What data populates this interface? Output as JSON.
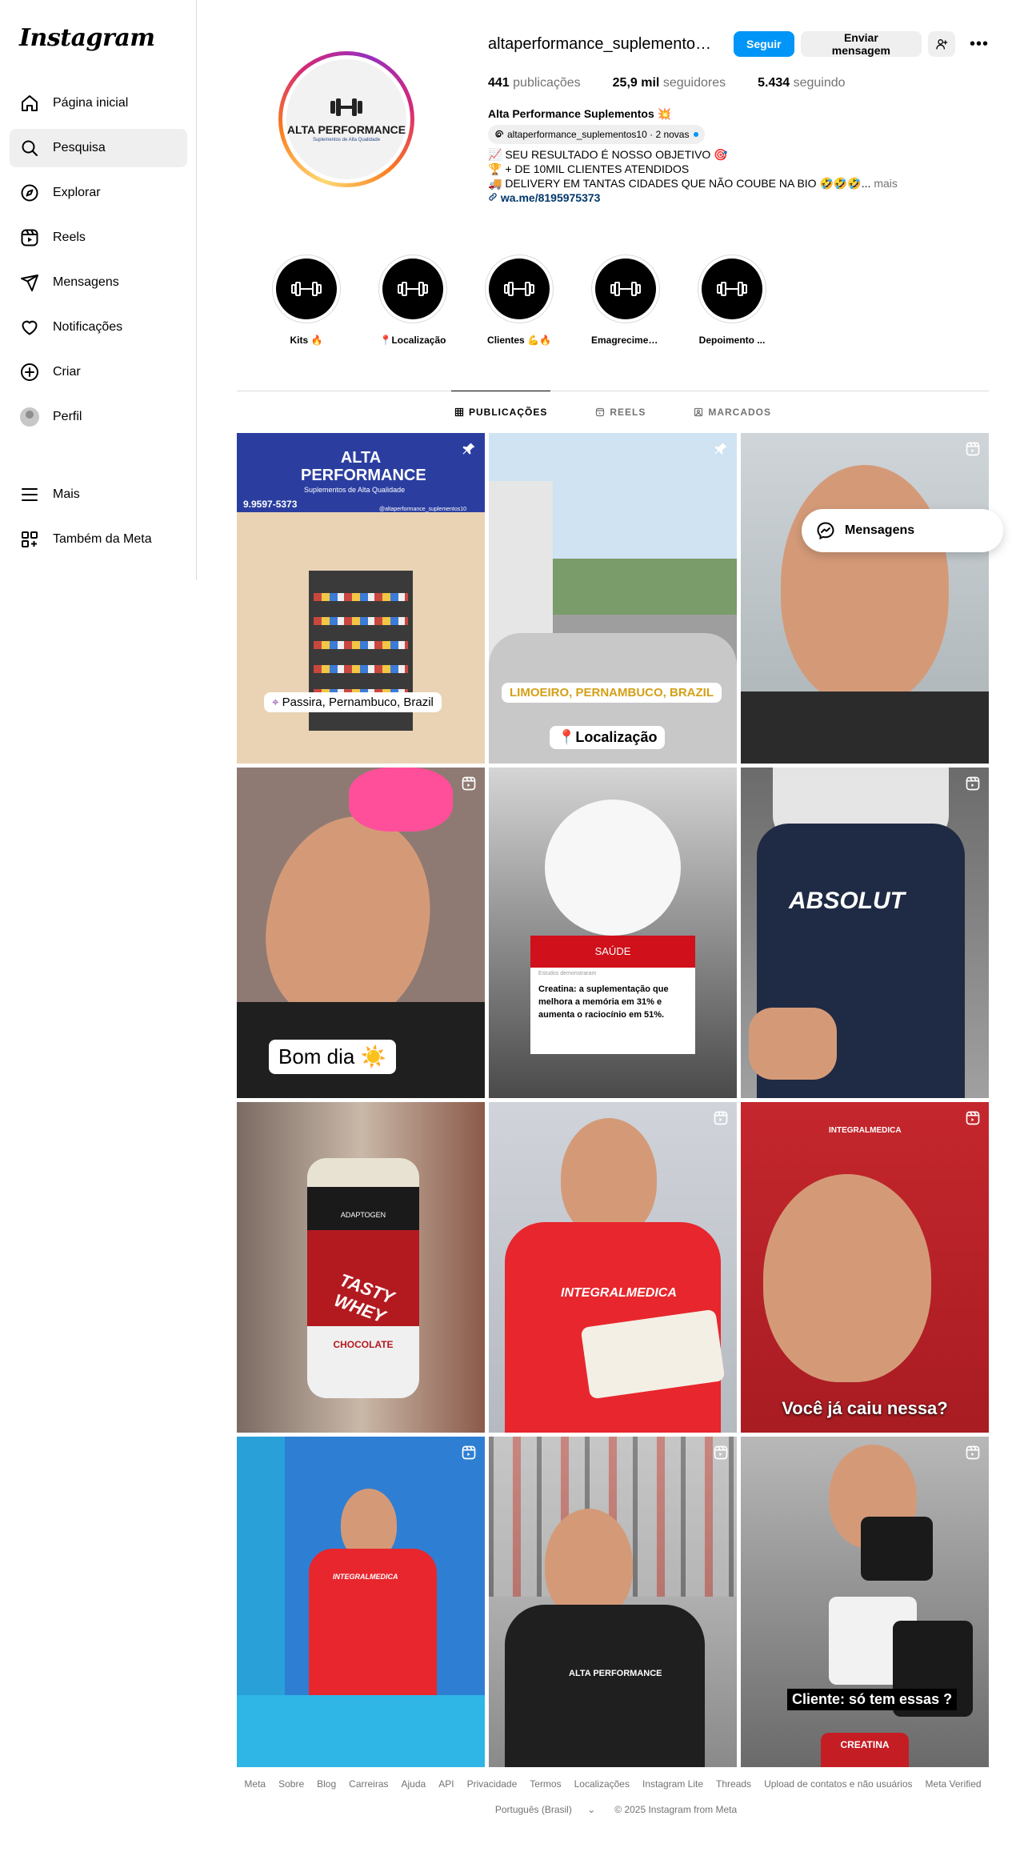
{
  "app": {
    "logo_text": "Instagram"
  },
  "sidebar": {
    "items": [
      {
        "label": "Página inicial",
        "icon": "home-icon"
      },
      {
        "label": "Pesquisa",
        "icon": "search-icon",
        "active": true
      },
      {
        "label": "Explorar",
        "icon": "compass-icon"
      },
      {
        "label": "Reels",
        "icon": "reels-icon"
      },
      {
        "label": "Mensagens",
        "icon": "messenger-icon"
      },
      {
        "label": "Notificações",
        "icon": "heart-icon"
      },
      {
        "label": "Criar",
        "icon": "plus-square-icon"
      },
      {
        "label": "Perfil",
        "icon": "avatar"
      }
    ],
    "bottom_items": [
      {
        "label": "Mais",
        "icon": "menu-icon"
      },
      {
        "label": "Também da Meta",
        "icon": "meta-apps-icon"
      }
    ]
  },
  "profile": {
    "username": "altaperformance_suplementos...",
    "follow_label": "Seguir",
    "message_label": "Enviar mensagem",
    "more_label": "•••",
    "stats": {
      "posts_value": "441",
      "posts_label": "publicações",
      "followers_value": "25,9 mil",
      "followers_label": "seguidores",
      "following_value": "5.434",
      "following_label": "seguindo"
    },
    "picture": {
      "brand": "ALTA PERFORMANCE",
      "tagline": "Suplementos de Alta Qualidade"
    },
    "bio": {
      "name": "Alta Performance Suplementos 💥",
      "threads_handle": "altaperformance_suplementos10 · 2 novas",
      "line1": "📈 SEU RESULTADO É NOSSO OBJETIVO 🎯",
      "line2": "🏆 + DE 10MIL CLIENTES ATENDIDOS",
      "line3": "🚚 DELIVERY EM TANTAS CIDADES QUE NÃO COUBE NA BIO 🤣🤣🤣...",
      "more": "mais",
      "link": "wa.me/8195975373"
    }
  },
  "highlights": [
    {
      "label": "Kits 🔥"
    },
    {
      "label": "📍Localização"
    },
    {
      "label": "Clientes 💪🔥"
    },
    {
      "label": "Emagrecimen..."
    },
    {
      "label": "Depoimento ..."
    }
  ],
  "tabs": [
    {
      "label": "PUBLICAÇÕES",
      "active": true,
      "icon": "grid-icon"
    },
    {
      "label": "REELS",
      "active": false,
      "icon": "reels-tab-icon"
    },
    {
      "label": "MARCADOS",
      "active": false,
      "icon": "tagged-icon"
    }
  ],
  "posts": [
    {
      "type": "pinned",
      "caption": "Passira, Pernambuco, Brazil",
      "banner_title": "ALTA PERFORMANCE",
      "banner_sub": "Suplementos de Alta Qualidade",
      "phone": "9.9597-5373",
      "handle": "@altaperformance_suplementos10"
    },
    {
      "type": "pinned",
      "caption": "LIMOEIRO, PERNAMBUCO, BRAZIL",
      "caption2": "📍Localização"
    },
    {
      "type": "reel"
    },
    {
      "type": "reel",
      "caption": "Bom dia ☀️"
    },
    {
      "type": "image",
      "card_header": "SAÚDE",
      "card_kicker": "Estudos demonstraram",
      "card_text": "Creatina: a suplementação que melhora a memória em 31% e aumenta o raciocínio em 51%."
    },
    {
      "type": "reel",
      "shirt_text": "ABSOLUT"
    },
    {
      "type": "image",
      "jar_brand": "ADAPTOGEN",
      "jar_title": "TASTY WHEY",
      "jar_flavor": "CHOCOLATE"
    },
    {
      "type": "reel",
      "shirt_text": "INTEGRALMEDICA"
    },
    {
      "type": "reel",
      "caption": "Você já caiu nessa?",
      "bag_brand": "INTEGRALMEDICA"
    },
    {
      "type": "reel",
      "shirt_text": "INTEGRALMEDICA"
    },
    {
      "type": "reel",
      "shirt_text": "ALTA PERFORMANCE"
    },
    {
      "type": "reel",
      "caption": "Cliente: só tem essas ?",
      "product_label": "CREATINA"
    }
  ],
  "floating_messages": {
    "label": "Mensagens"
  },
  "footer": {
    "links": [
      "Meta",
      "Sobre",
      "Blog",
      "Carreiras",
      "Ajuda",
      "API",
      "Privacidade",
      "Termos",
      "Localizações",
      "Instagram Lite",
      "Threads",
      "Upload de contatos e não usuários",
      "Meta Verified"
    ],
    "language": "Português (Brasil)",
    "copyright": "© 2025 Instagram from Meta"
  },
  "colors": {
    "primary": "#0095f6",
    "link": "#00376b",
    "muted": "#737373"
  }
}
